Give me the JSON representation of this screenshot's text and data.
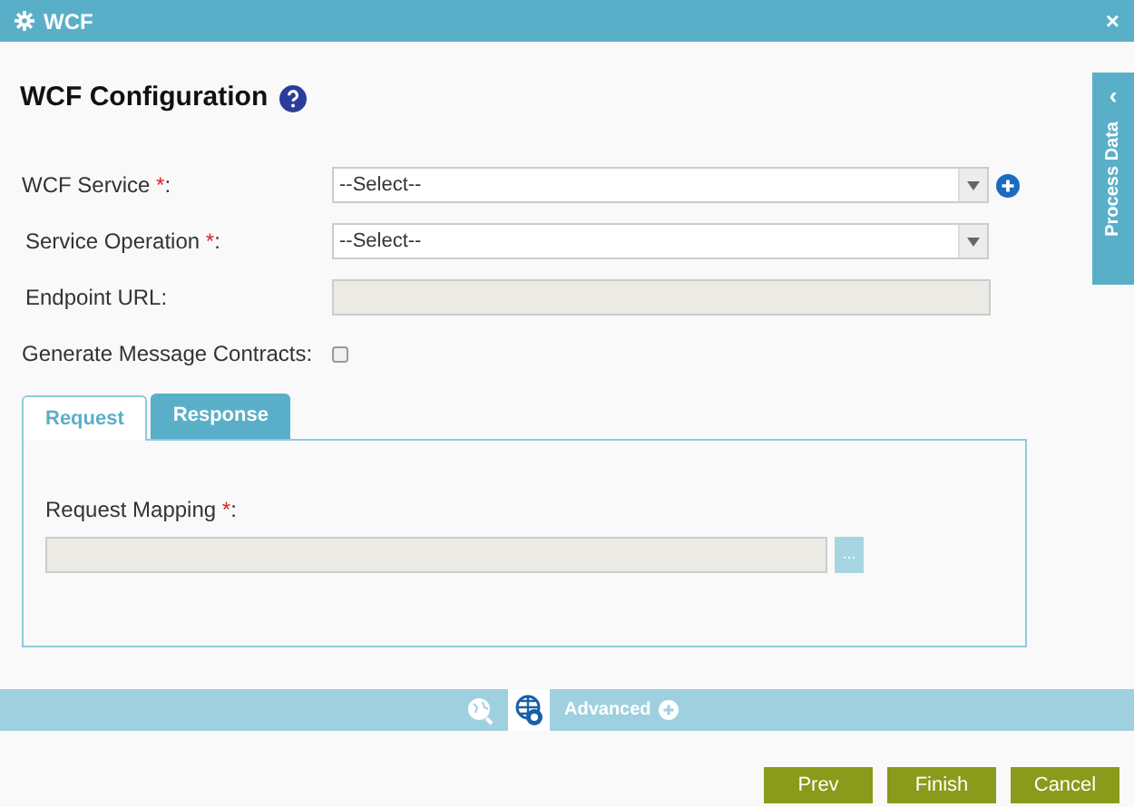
{
  "window": {
    "title": "WCF",
    "close": "×"
  },
  "heading": "WCF Configuration",
  "side_tab": {
    "label": "Process Data",
    "arrow": "‹"
  },
  "fields": [
    {
      "kind": "select",
      "label": "WCF Service ",
      "mark": "*",
      "suffix": ":",
      "value": "--Select--",
      "add": true
    },
    {
      "kind": "select",
      "label": "Service Operation ",
      "mark": "*",
      "suffix": ":",
      "value": "--Select--",
      "add": false
    },
    {
      "kind": "text",
      "label": "Endpoint URL:",
      "disabled": true
    },
    {
      "kind": "checkbox",
      "label": "Generate Message Contracts:",
      "checked": false
    }
  ],
  "tabs": [
    {
      "label": "Request",
      "selected": true
    },
    {
      "label": "Response",
      "selected": false
    }
  ],
  "mapping": {
    "label": "Request Mapping ",
    "mark": "*",
    "suffix": ":",
    "button": "..."
  },
  "toolbar": {
    "icons": [
      {
        "selected": false
      },
      {
        "selected": true
      }
    ],
    "label": "Advanced"
  },
  "buttons": [
    "Prev",
    "Finish",
    "Cancel"
  ]
}
